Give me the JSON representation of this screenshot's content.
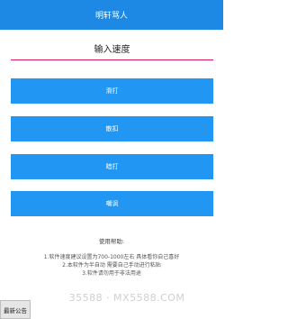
{
  "titlebar": {
    "title": "明轩骂人"
  },
  "speed_input": {
    "placeholder": "输入速度",
    "value": ""
  },
  "buttons": [
    {
      "label": "滑打"
    },
    {
      "label": "散扣"
    },
    {
      "label": "暗打"
    },
    {
      "label": "嘲讽"
    }
  ],
  "help": {
    "title": "使用帮助:",
    "lines": [
      "1.软件速度建议设置为700-1000左右 具体看你自己喜好",
      "2.本软件为半自动 需要自己手动进行粘贴",
      "3.软件请勿用于非法用途"
    ]
  },
  "notice_tab": {
    "label": "最新公告"
  },
  "watermark": {
    "text": "35588 · MX5588.COM"
  },
  "colors": {
    "primary": "#2196f3",
    "titlebar": "#1e88e5",
    "input_underline": "#d81b60"
  }
}
